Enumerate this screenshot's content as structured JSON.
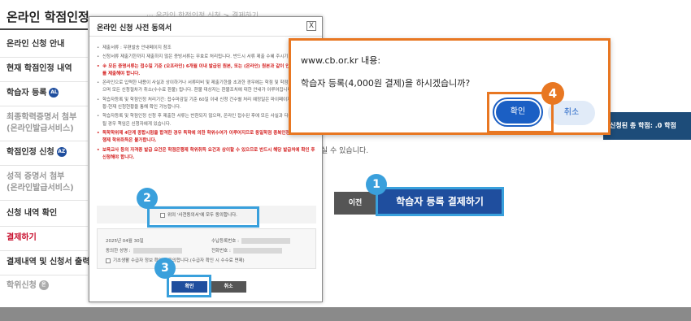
{
  "page": {
    "title": "온라인 학점인정",
    "breadcrumb": "··· 온라인 학점인정 신청 > 결제하기"
  },
  "sidebar": {
    "items": [
      {
        "label": "온라인 신청 안내"
      },
      {
        "label": "현재 학점인정 내역"
      },
      {
        "label": "학습자 등록",
        "badge": "AL"
      },
      {
        "label": "최종학력증명서 첨부"
      },
      {
        "label": "(온라인발급서비스)"
      },
      {
        "label": "학점인정 신청",
        "badge": "AZ"
      },
      {
        "label": "성적 증명서 첨부"
      },
      {
        "label": "(온라인발급서비스)"
      },
      {
        "label": "신청 내역 확인"
      },
      {
        "label": "결제하기"
      },
      {
        "label": "결제내역 및 신청서 출력"
      },
      {
        "label": "학위신청",
        "badge": "온"
      }
    ]
  },
  "main": {
    "total_credits": "신청된 총 학점: .0 학점",
    "notice": "신청하실 수 있습니다.",
    "prev_button": "이전",
    "register_button": "학습자 등록 결제하기"
  },
  "modal": {
    "title": "온라인 신청 사전 동의서",
    "close": "X",
    "paragraphs": [
      {
        "text": "제출서류 : 우편발송 안내페이지 참조",
        "red": false
      },
      {
        "text": "신청서류 제출기한까지 제출하지 않은 증빙서류는 무효로 처리됩니다. 반드시 서류 제출 수혜 주시기 바랍니다.",
        "red": false
      },
      {
        "text": "※ 모든 증명서류는 접수일 기준 (오프라인) 6개월 이내 발급된 원본, 또는 (온라인) 원본과 같이 인정된 발급서류를 제출해야 합니다.",
        "red": true
      },
      {
        "text": "온라인으로 입력한 내용이 사실과 상이하거나 서류미비 및 제출기한을 초과한 경우에는 학점 및 학점인정이 되지 않으며 모든 신청절차가 취소(수수료 환불) 됩니다. 환불 대상자는 환불조치에 대한 안내가 이루어집니다.",
        "red": false
      },
      {
        "text": "학습자등록 및 학점인정 처리기간: 접수마감일 기준 60일 이내 신청 건수별 처리 예정일은 마이페이지-각종 접수현황-현재 신청현황을 통해 확인 가능합니다.",
        "red": false
      },
      {
        "text": "학습자등록 및 학점인정 신청 후 제출한 서류는 반환되지 않으며, 온라인 접수된 후에 모든 사실과 다른 내용이 발견될 경우 책임은 신청자에게 있습니다.",
        "red": false
      },
      {
        "text": "독학학위제 4단계 종합시험을 합격한 경우 독학에 의한 학위수여가 이루어지므로 동일학점 중복인정을 통한 학점은행제 학위취득은 불가합니다.",
        "red": true
      },
      {
        "text": "보육교사 등의 자격증 발급 요건은 학점은행제 학위취득 요건과 상이할 수 있으므로 반드시 해당 발급처에 확인 후 신청해야 합니다.",
        "red": true
      }
    ],
    "agree_label": "위의 '사전동의서'에 모두 동의합니다.",
    "info": {
      "date": "2025년 04월 30일",
      "applicant_label": "동의한 성명 :",
      "reg_label": "수납등록번호 :",
      "phone_label": "전화번호 :",
      "basic_label": "기초생활 수급자 정보 확인에 동의합니다.(수급자 확인 시 수수료 면제)"
    },
    "ok_button": "확인",
    "cancel_button": "취소"
  },
  "confirm_dialog": {
    "title": "www.cb.or.kr 내용:",
    "message": "학습자 등록(4,000원 결제)을 하시겠습니까?",
    "ok_button": "확인",
    "cancel_button": "취소"
  },
  "annotations": {
    "step1": "1",
    "step2": "2",
    "step3": "3",
    "step4": "4"
  },
  "colors": {
    "primary_navy": "#1f4e9e",
    "highlight_blue": "#39a0dc",
    "highlight_orange": "#e87722",
    "alert_red": "#d42020"
  }
}
